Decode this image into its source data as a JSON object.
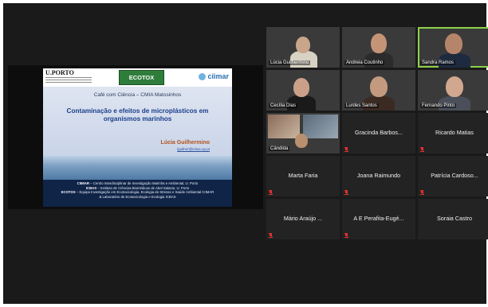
{
  "slide": {
    "institution_top": "U.PORTO",
    "ecotox_logo": "ECOTOX",
    "ciimar_logo": "ciimar",
    "session_line": "Café com Ciência – CMIA Matosinhos",
    "title": "Contaminação e efeitos de microplásticos em organismos marinhos",
    "speaker": "Lúcia Guilhermino",
    "email": "lguilher@icbas.up.pt",
    "footer": [
      {
        "bold": "CIIMAR",
        "text": " – Centro Interdisciplinar de Investigação Marinha e Ambiental, U. Porto"
      },
      {
        "bold": "ICBAS",
        "text": " – Instituto de Ciências Biomédicas de Abel Salazar, U. Porto"
      },
      {
        "bold": "ECOTOX",
        "text": " – Equipa Investigação em Ecotoxicologia, Ecologia de Stresse e Saúde Ambiental CIIMAR"
      },
      {
        "bold": "",
        "text": "& Laboratório de Ecotoxicologia e Ecologia ICBAS"
      }
    ]
  },
  "participants": {
    "video": [
      {
        "name": "Lúcia Guilhermino"
      },
      {
        "name": "Andreia Coutinho"
      },
      {
        "name": "Sandra Ramos"
      },
      {
        "name": "Cecília Dias"
      },
      {
        "name": "Lurdes Santos"
      },
      {
        "name": "Fernando Pinto"
      },
      {
        "name": "Cândida"
      }
    ],
    "named": [
      {
        "name": "Gracinda Barbos..."
      },
      {
        "name": "Ricardo Matias"
      },
      {
        "name": "Marta Faria"
      },
      {
        "name": "Joana Raimundo"
      },
      {
        "name": "Patrícia Cardoso..."
      },
      {
        "name": "Mário Araújo ..."
      },
      {
        "name": "A E Perafita-Eugé..."
      },
      {
        "name": "Soraia Castro"
      }
    ]
  },
  "colors": {
    "active_speaker_border": "#8ed14b",
    "muted_mic": "#e03030",
    "slide_title": "#1a3e8c"
  }
}
